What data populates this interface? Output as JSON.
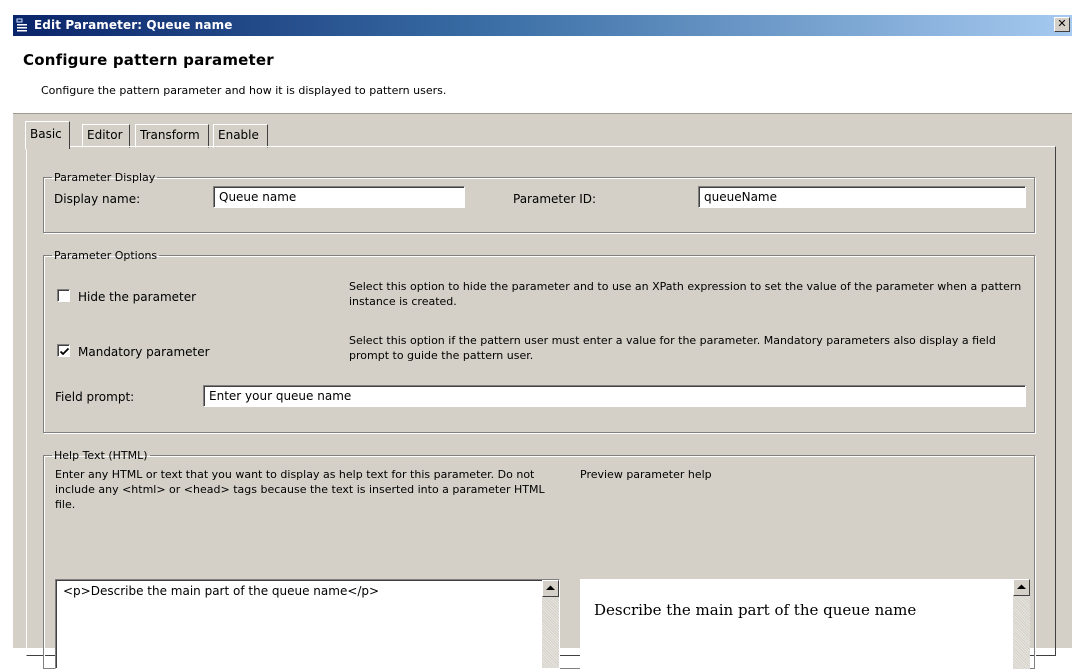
{
  "window": {
    "title": "Edit Parameter: Queue name",
    "close_symbol": "✕"
  },
  "header": {
    "title": "Configure pattern parameter",
    "description": "Configure the pattern parameter and how it is displayed to pattern users."
  },
  "tabs": [
    {
      "label": "Basic",
      "active": true
    },
    {
      "label": "Editor",
      "active": false
    },
    {
      "label": "Transform",
      "active": false
    },
    {
      "label": "Enable",
      "active": false
    }
  ],
  "parameter_display": {
    "legend": "Parameter Display",
    "display_name_label": "Display name:",
    "display_name_value": "Queue name",
    "parameter_id_label": "Parameter ID:",
    "parameter_id_value": "queueName"
  },
  "parameter_options": {
    "legend": "Parameter Options",
    "hide": {
      "label": "Hide the parameter",
      "checked": false,
      "description": "Select this option to hide the parameter and to use an XPath expression to set the value of the parameter when a pattern instance is created."
    },
    "mandatory": {
      "label": "Mandatory parameter",
      "checked": true,
      "description": "Select this option if the pattern user must enter a value for the parameter. Mandatory parameters also display a field prompt to guide the pattern user."
    },
    "field_prompt_label": "Field prompt:",
    "field_prompt_value": "Enter your queue name"
  },
  "help_text": {
    "legend": "Help Text (HTML)",
    "instructions": "Enter any HTML or text that you want to display as help text for this parameter. Do not include any <html> or <head> tags because the text is inserted into a parameter HTML file.",
    "preview_label": "Preview parameter help",
    "editor_value": "<p>Describe the main part of the queue name</p>",
    "preview_value": "Describe the main part of the queue name"
  },
  "icons": {
    "window": "parameter-icon",
    "checkbox_mark": "checkmark-icon",
    "scroll": "scroll-up-arrow-icon"
  },
  "colors": {
    "title_gradient_start": "#0a246a",
    "title_gradient_end": "#a6caf0",
    "dialog_face": "#d4d0c8"
  }
}
